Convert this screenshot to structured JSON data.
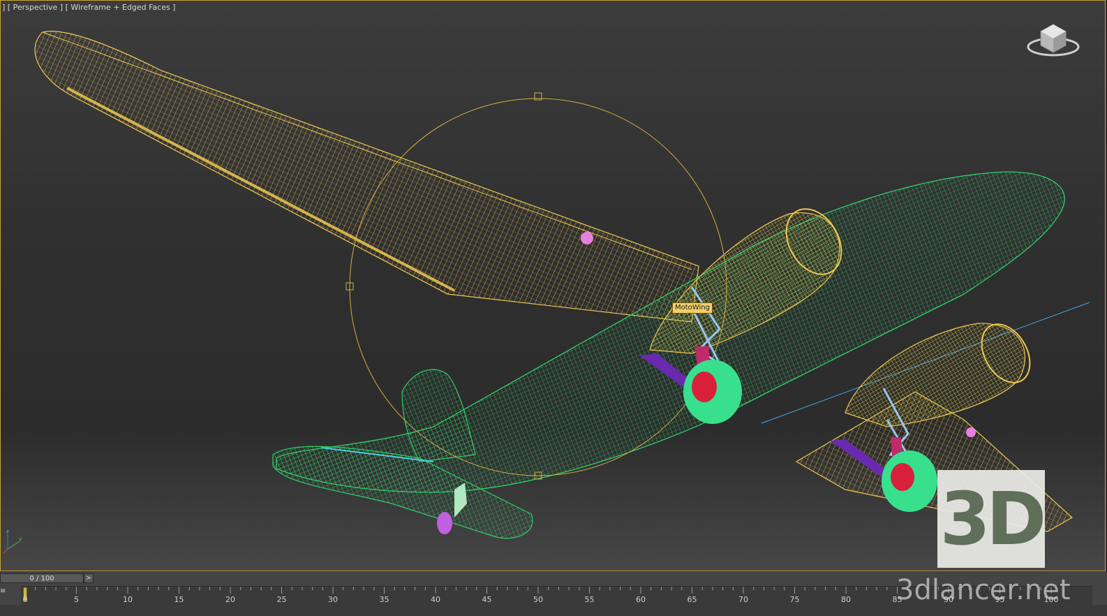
{
  "viewport": {
    "label": "] [ Perspective ] [ Wireframe + Edged Faces ]",
    "object_tag": "MotoWing"
  },
  "timeline": {
    "frame_display": "0 / 100",
    "next_button": ">",
    "ticks": [
      0,
      5,
      10,
      15,
      20,
      25,
      30,
      35,
      40,
      45,
      50,
      55,
      60,
      65,
      70,
      75,
      80,
      85,
      90,
      95,
      100
    ]
  },
  "axis": {
    "x": "x",
    "y": "y",
    "z": "z"
  },
  "watermark": {
    "badge": "3D",
    "site": "3dlancer.net"
  },
  "colors": {
    "wing_wire": "#f0c850",
    "fuselage_wire": "#2fcf6a",
    "wheel": "#38e08e",
    "hub": "#d8203a",
    "strut_blue": "#9cc4f0",
    "strut_magenta": "#c02a6a",
    "purple": "#6a2ab0",
    "pink": "#e880e0"
  }
}
